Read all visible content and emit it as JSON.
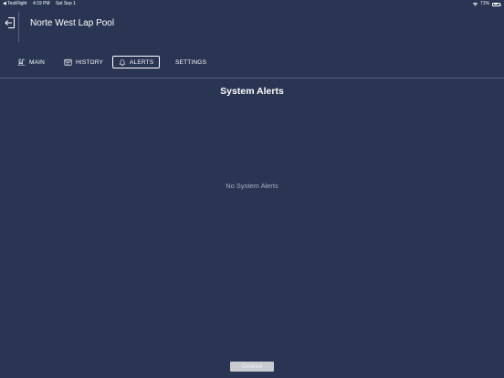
{
  "status_bar": {
    "back_app": "◀ TestFlight",
    "time": "4:19 PM",
    "date": "Sat Sep 1",
    "battery_pct": "71%"
  },
  "header": {
    "title": "Norte West Lap Pool"
  },
  "nav": {
    "items": [
      {
        "label": "MAIN",
        "icon": "pool-ladder-icon"
      },
      {
        "label": "HISTORY",
        "icon": "calendar-icon"
      },
      {
        "label": "ALERTS",
        "icon": "bell-icon",
        "active": true
      },
      {
        "label": "SETTINGS"
      }
    ]
  },
  "alerts": {
    "section_title": "System Alerts",
    "empty_message": "No System Alerts",
    "cleared_label": "Cleared"
  },
  "colors": {
    "background": "#2a3553",
    "divider": "#56627f",
    "muted_text": "#a9b1c4",
    "button_disabled": "#c9cbd0"
  }
}
